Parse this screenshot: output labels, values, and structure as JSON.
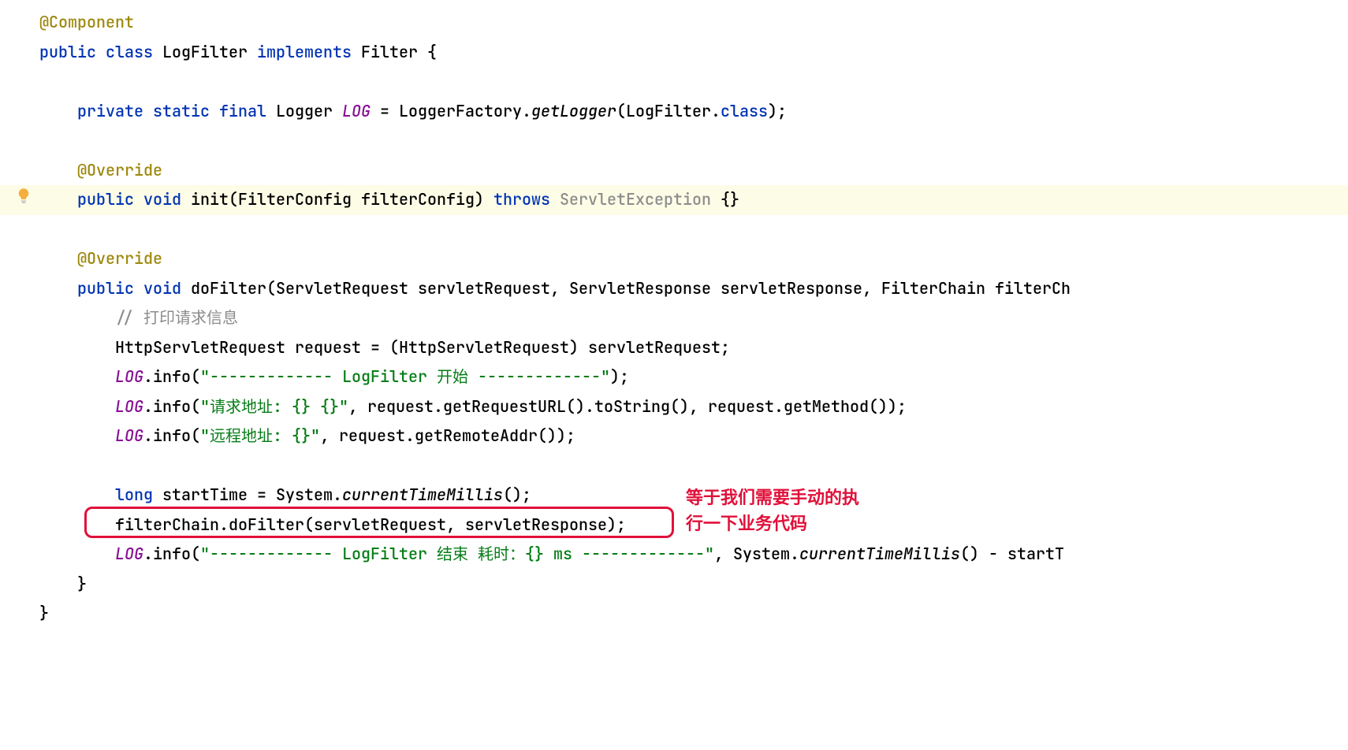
{
  "code": {
    "annotation_component": "@Component",
    "class_decl_public": "public",
    "class_decl_class": "class",
    "class_name": "LogFilter",
    "class_decl_implements": "implements",
    "interface_name": "Filter",
    "brace_open": "{",
    "brace_close": "}",
    "private": "private",
    "static": "static",
    "final": "final",
    "logger_type": "Logger",
    "logger_var": "LOG",
    "logger_factory": "LoggerFactory",
    "get_logger": "getLogger",
    "logfilter_class": "LogFilter",
    "dot_class": "class",
    "annotation_override": "@Override",
    "public": "public",
    "void": "void",
    "init_method": "init",
    "filterconfig_type": "FilterConfig",
    "filterconfig_param": "filterConfig",
    "throws": "throws",
    "servlet_exception": "ServletException",
    "empty_braces": "{}",
    "dofilter_method": "doFilter",
    "servlet_request_type": "ServletRequest",
    "servlet_request_param": "servletRequest",
    "servlet_response_type": "ServletResponse",
    "servlet_response_param": "servletResponse",
    "filterchain_type": "FilterChain",
    "filterchain_param": "filterCh",
    "comment_print": "// 打印请求信息",
    "http_servlet_request": "HttpServletRequest",
    "request_var": "request",
    "cast_open": "(HttpServletRequest)",
    "log_var": "LOG",
    "info_method": "info",
    "string_begin": "\"------------- LogFilter 开始 -------------\"",
    "string_addr": "\"请求地址: {} {}\"",
    "get_request_url": "getRequestURL",
    "to_string": "toString",
    "get_method": "getMethod",
    "string_remote": "\"远程地址: {}\"",
    "get_remote_addr": "getRemoteAddr",
    "long": "long",
    "start_time": "startTime",
    "system": "System",
    "current_time_millis": "currentTimeMillis",
    "filter_chain_var": "filterChain",
    "string_end": "\"------------- LogFilter 结束 耗时：{} ms -------------\"",
    "start_t_cut": "startT"
  },
  "callout": {
    "line1": "等于我们需要手动的执",
    "line2": "行一下业务代码"
  }
}
